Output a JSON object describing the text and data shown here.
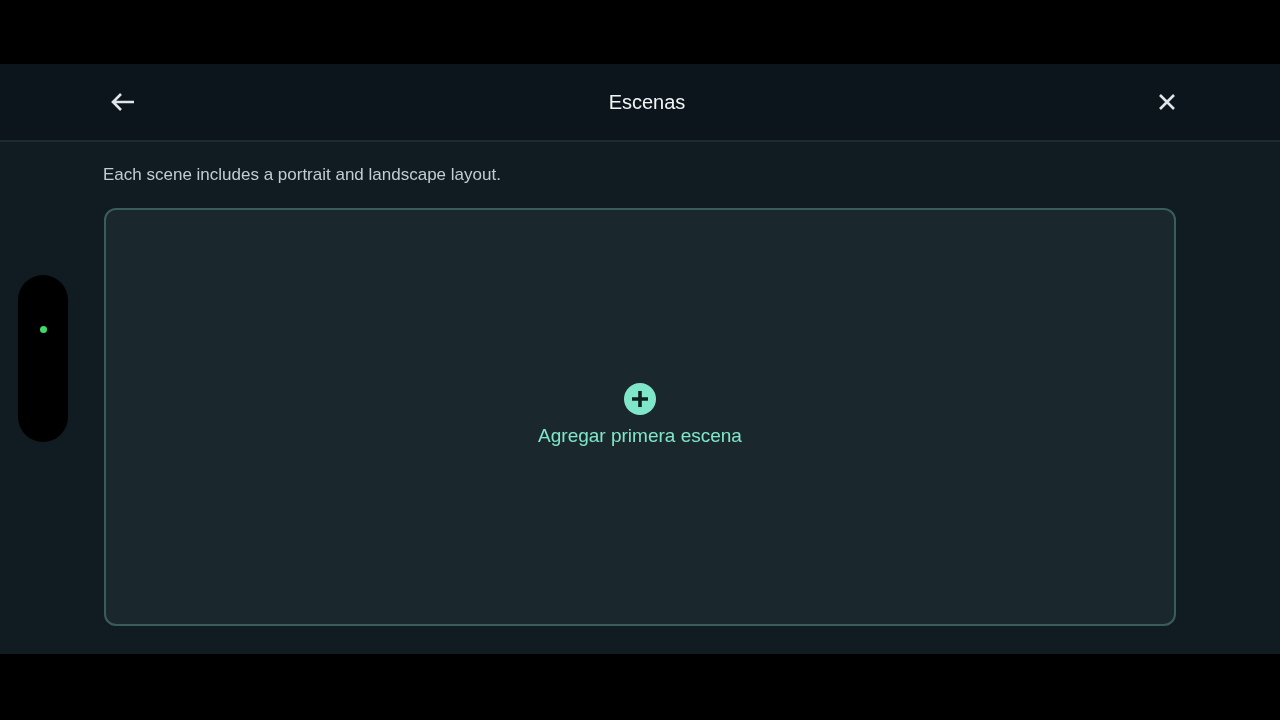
{
  "header": {
    "title": "Escenas"
  },
  "description": "Each scene includes a portrait and landscape layout.",
  "empty_card": {
    "action": "Agregar primera escena"
  }
}
